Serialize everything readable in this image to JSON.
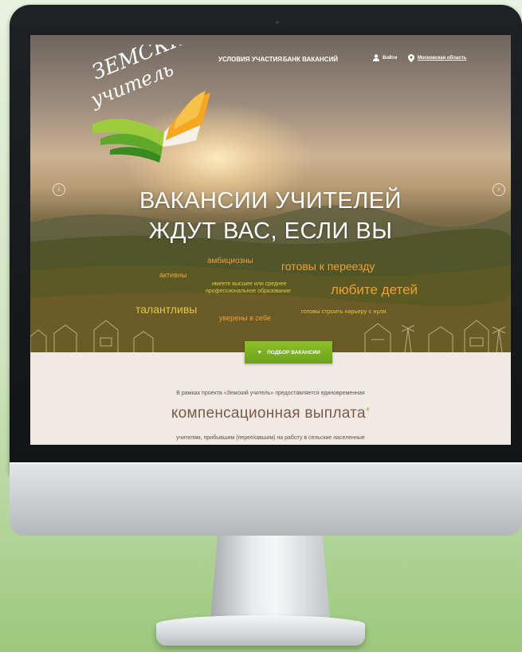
{
  "header": {
    "nav": [
      "УСЛОВИЯ УЧАСТИЯ",
      "БАНК ВАКАНСИЙ"
    ],
    "login_label": "Войти",
    "region_label": "Московская область"
  },
  "logo": {
    "line1": "ЗЕМСКИЙ",
    "line2": "учитель"
  },
  "hero": {
    "title_line1": "ВАКАНСИИ УЧИТЕЛЕЙ",
    "title_line2": "ЖДУТ ВАС, ЕСЛИ ВЫ",
    "traits": {
      "ambitious": "амбициозны",
      "relocate": "готовы к переезду",
      "active": "активны",
      "education_line1": "имеете высшее или среднее",
      "education_line2": "профессиональное образование",
      "children": "любите детей",
      "talented": "талантливы",
      "confident": "уверены в себе",
      "career": "готовы строить карьеру с нуля"
    },
    "cta_label": "ПОДБОР ВАКАНСИИ"
  },
  "info": {
    "intro": "В рамках проекта «Земский учитель» предоставляется единовременная",
    "highlight": "компенсационная выплата",
    "highlight_mark": "*",
    "tail": "учителям, прибывшим (переехавшим) на работу в сельские населенные"
  },
  "colors": {
    "accent_green": "#8cc02a",
    "trait_orange": "#f0a030",
    "trait_yellow": "#e8c640",
    "highlight_brown": "#7b5a4a"
  }
}
